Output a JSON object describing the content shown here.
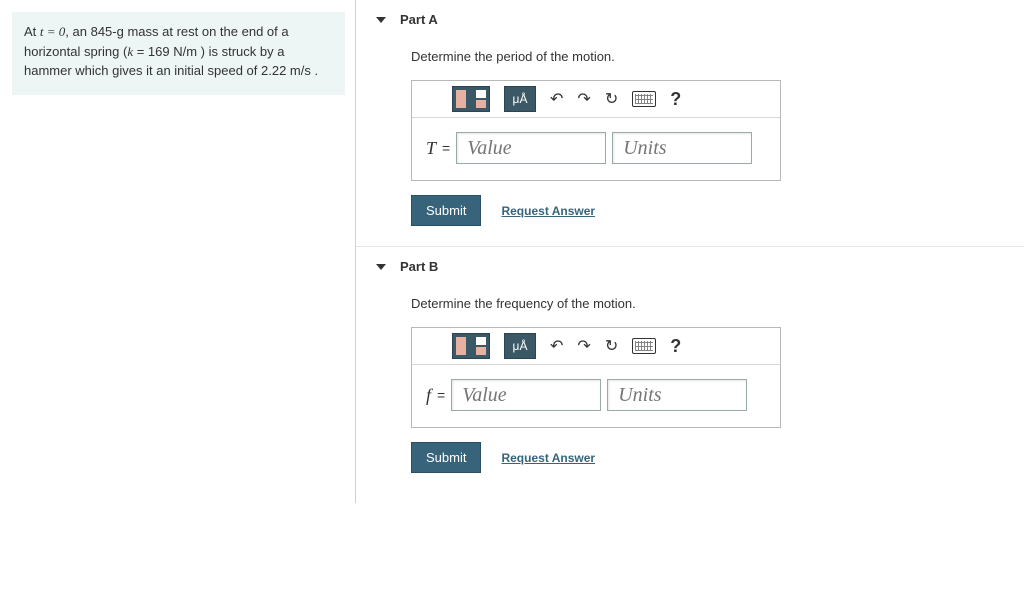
{
  "prompt": {
    "text_1": "At ",
    "t_eq": "t = 0",
    "text_2": ", an 845-g mass at rest on the end of a horizontal spring (",
    "k_eq": "k",
    "text_3": " = 169  N/m ) is struck by a hammer which gives it an initial speed of 2.22  m/s ."
  },
  "parts": [
    {
      "title": "Part A",
      "instruction": "Determine the period of the motion.",
      "var": "T",
      "value_ph": "Value",
      "units_ph": "Units",
      "toolbar_mu": "μÅ",
      "submit": "Submit",
      "request": "Request Answer"
    },
    {
      "title": "Part B",
      "instruction": "Determine the frequency of the motion.",
      "var": "f",
      "value_ph": "Value",
      "units_ph": "Units",
      "toolbar_mu": "μÅ",
      "submit": "Submit",
      "request": "Request Answer"
    }
  ]
}
